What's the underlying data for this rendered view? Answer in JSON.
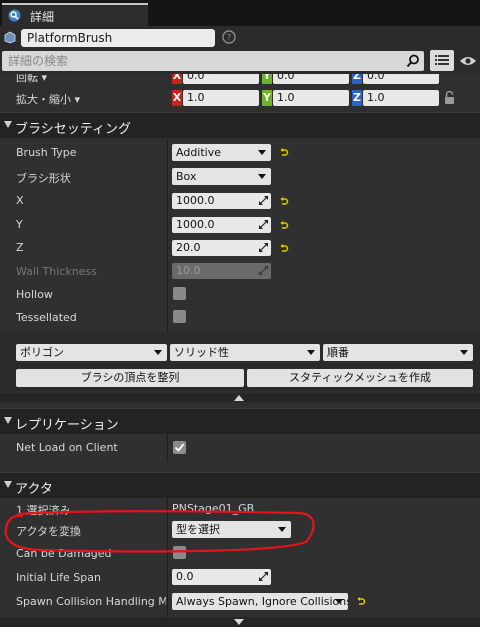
{
  "tab": {
    "title": "詳細"
  },
  "header": {
    "object_name": "PlatformBrush",
    "search_placeholder": "詳細の検索"
  },
  "transform": {
    "rotation_label": "回転 ▾",
    "rotation_x": "0.0 °",
    "rotation_y": "0.0 °",
    "rotation_z": "0.0 °",
    "scale_label": "拡大・縮小 ▾",
    "scale_x": "1.0",
    "scale_y": "1.0",
    "scale_z": "1.0",
    "axis_x": "X",
    "axis_y": "Y",
    "axis_z": "Z"
  },
  "brush_settings": {
    "title": "ブラシセッティング",
    "brush_type_label": "Brush Type",
    "brush_type_value": "Additive",
    "brush_shape_label": "ブラシ形状",
    "brush_shape_value": "Box",
    "x_label": "X",
    "x_value": "1000.0",
    "y_label": "Y",
    "y_value": "1000.0",
    "z_label": "Z",
    "z_value": "20.0",
    "wall_label": "Wall Thickness",
    "wall_value": "10.0",
    "hollow_label": "Hollow",
    "tessellated_label": "Tessellated"
  },
  "brush_tools": {
    "polygon": "ポリゴン",
    "solidity": "ソリッド性",
    "order": "順番",
    "align_vertices": "ブラシの頂点を整列",
    "create_static_mesh": "スタティックメッシュを作成"
  },
  "replication": {
    "title": "レプリケーション",
    "net_load_label": "Net Load on Client",
    "net_load_checked": true
  },
  "actor": {
    "title": "アクタ",
    "selected_label": "1 選択済み",
    "selected_value": "PNStage01_GB",
    "convert_label": "アクタを変換",
    "convert_value": "型を選択",
    "can_be_damaged_label": "Can be Damaged",
    "initial_life_label": "Initial Life Span",
    "initial_life_value": "0.0",
    "spawn_label": "Spawn Collision Handling Meth",
    "spawn_value": "Always Spawn, Ignore Collisions"
  },
  "colors": {
    "axis_x": "#c8231c",
    "axis_y": "#6cb42c",
    "axis_z": "#2d63c9",
    "annotation": "#e3141b",
    "reset_arrow": "#e8c700"
  }
}
